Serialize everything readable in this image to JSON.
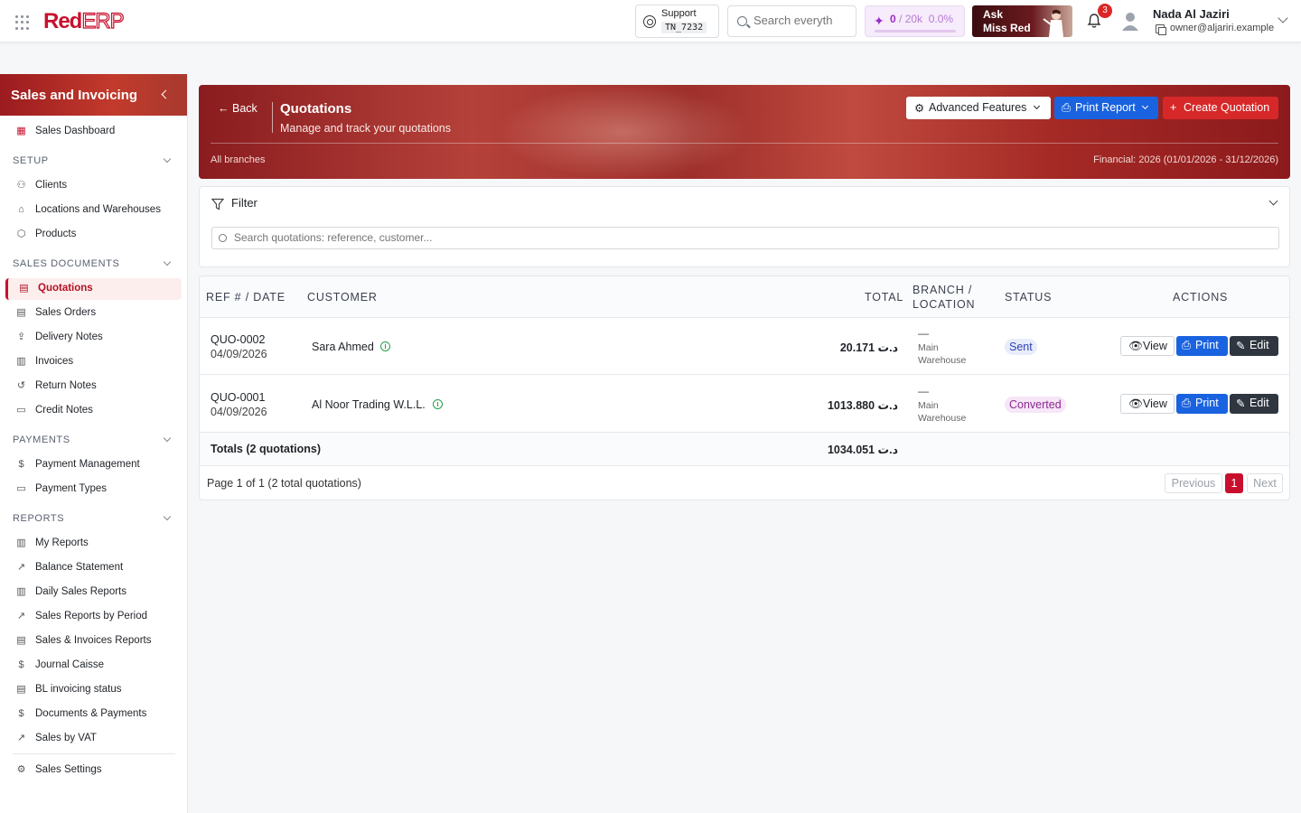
{
  "topbar": {
    "logo_red": "Red",
    "logo_erp": "ERP",
    "support_label": "Support",
    "support_code": "TN_7232",
    "search_placeholder": "Search everyth",
    "credits_used": "0",
    "credits_total": "/ 20k",
    "credits_percent": "0.0%",
    "credits_fraction": 0,
    "ask_line1": "Ask",
    "ask_line2": "Miss Red",
    "notification_count": "3",
    "user_name": "Nada Al Jaziri",
    "user_email": "owner@aljariri.example"
  },
  "sidebar": {
    "title": "Sales and Invoicing",
    "dashboard": "Sales Dashboard",
    "sections": {
      "setup": "SETUP",
      "sales_documents": "SALES DOCUMENTS",
      "payments": "PAYMENTS",
      "reports": "REPORTS"
    },
    "setup_items": [
      "Clients",
      "Locations and Warehouses",
      "Products"
    ],
    "sales_items": [
      "Quotations",
      "Sales Orders",
      "Delivery Notes",
      "Invoices",
      "Return Notes",
      "Credit Notes"
    ],
    "payment_items": [
      "Payment Management",
      "Payment Types"
    ],
    "report_items": [
      "My Reports",
      "Balance Statement",
      "Daily Sales Reports",
      "Sales Reports by Period",
      "Sales & Invoices Reports",
      "Journal Caisse",
      "BL invoicing status",
      "Documents & Payments",
      "Sales by VAT"
    ],
    "settings": "Sales Settings"
  },
  "header": {
    "back": "Back",
    "title": "Quotations",
    "subtitle": "Manage and track your quotations",
    "branches": "All branches",
    "financial": "Financial: 2026 (01/01/2026 - 31/12/2026)",
    "advanced_features": "Advanced Features",
    "print_report": "Print Report",
    "create_quotation": "Create Quotation"
  },
  "filter": {
    "title": "Filter",
    "search_placeholder": "Search quotations: reference, customer..."
  },
  "table": {
    "columns": {
      "ref_date": "REF # / DATE",
      "customer": "CUSTOMER",
      "total": "TOTAL",
      "branch_line1": "BRANCH /",
      "branch_line2": "LOCATION",
      "status": "STATUS",
      "actions": "ACTIONS"
    },
    "rows": [
      {
        "ref": "QUO-0002",
        "date": "04/09/2026",
        "customer": "Sara Ahmed",
        "total": "20.171 د.ت",
        "branch": "—",
        "location_1": "Main",
        "location_2": "Warehouse",
        "status": "Sent",
        "status_color": "#2e44b5"
      },
      {
        "ref": "QUO-0001",
        "date": "04/09/2026",
        "customer": "Al Noor Trading W.L.L.",
        "total": "1013.880 د.ت",
        "branch": "—",
        "location_1": "Main",
        "location_2": "Warehouse",
        "status": "Converted",
        "status_color": "#8b2a8f"
      }
    ],
    "actions": {
      "view": "View",
      "print": "Print",
      "edit": "Edit"
    },
    "totals_label": "Totals (2 quotations)",
    "totals_value": "1034.051 د.ت",
    "pager_info": "Page 1 of 1 (2 total quotations)",
    "pager_prev": "Previous",
    "pager_current": "1",
    "pager_next": "Next"
  },
  "colors": {
    "brand": "#c8102e",
    "primary_blue": "#1a63e0",
    "create_red": "#d62828",
    "dark_button": "#2f3640"
  }
}
